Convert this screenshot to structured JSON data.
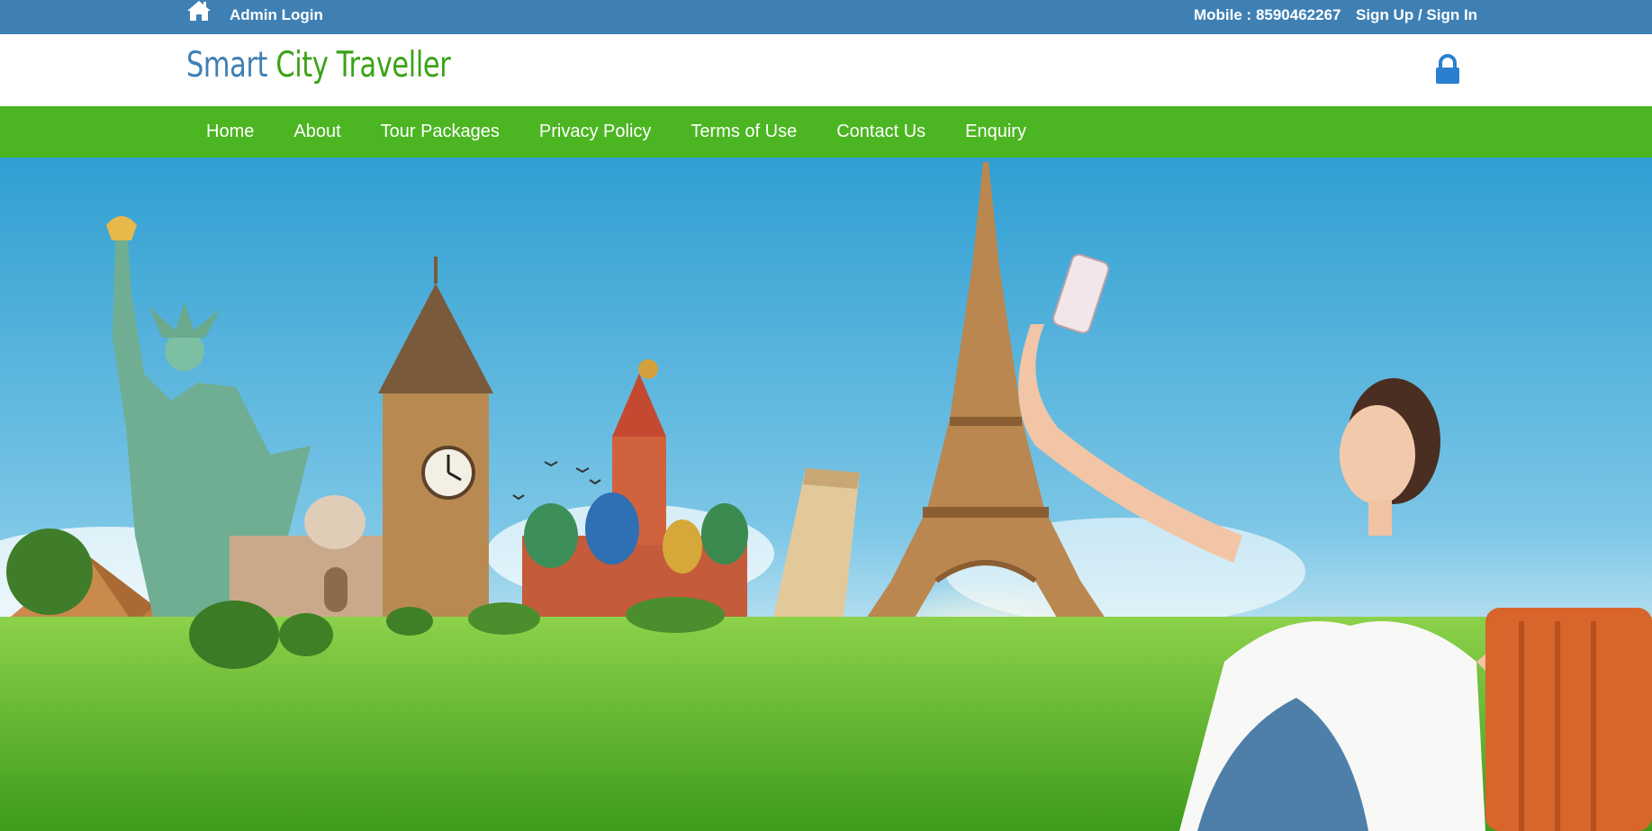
{
  "topbar": {
    "admin_label": "Admin Login",
    "mobile_text": "Mobile : 8590462267",
    "signup_label": "Sign Up / Sign In",
    "icons": {
      "home": "home-icon"
    }
  },
  "header": {
    "logo": {
      "word1": "Smart",
      "word2": "City",
      "word3": "Traveller"
    },
    "icons": {
      "account": "lock-icon"
    }
  },
  "nav": {
    "items": [
      {
        "label": "Home"
      },
      {
        "label": "About"
      },
      {
        "label": "Tour Packages"
      },
      {
        "label": "Privacy Policy"
      },
      {
        "label": "Terms of Use"
      },
      {
        "label": "Contact Us"
      },
      {
        "label": "Enquiry"
      }
    ]
  },
  "colors": {
    "topbar": "#3f80b4",
    "logo_primary": "#3f80b4",
    "logo_accent": "#3aa318",
    "nav": "#4cb522",
    "lock": "#2a7fd0"
  }
}
